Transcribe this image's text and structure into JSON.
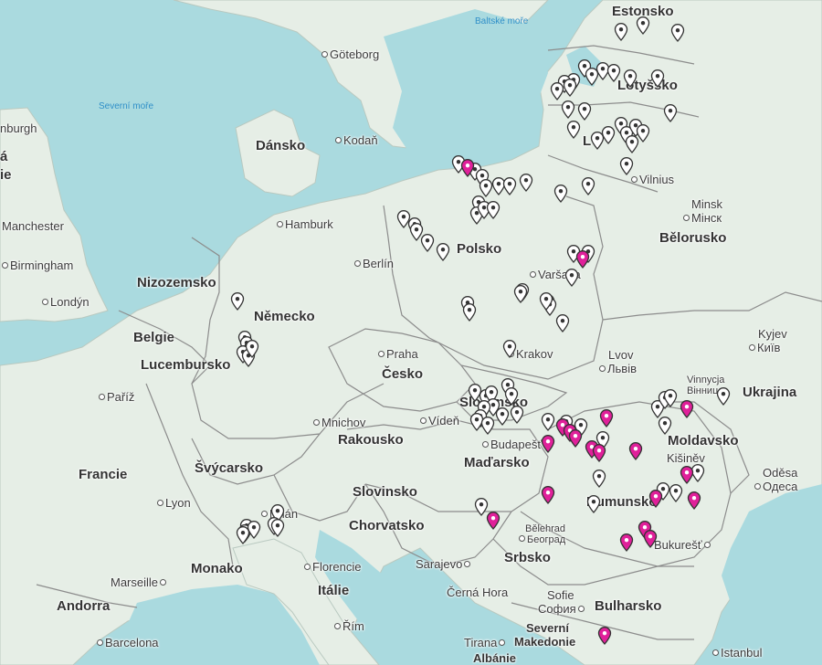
{
  "labels": {
    "estonsko": "Estonsko",
    "lotyssko": "Lotyšsko",
    "litva_partial": "L",
    "baltske_more": "Baltské moře",
    "goteborg": "Göteborg",
    "severni_more": "Severní moře",
    "edinburgh_partial": "nburgh",
    "ireland_partial_1": "á",
    "ireland_partial_2": "ie",
    "dansko": "Dánsko",
    "kodan": "Kodaň",
    "vilnius": "Vilnius",
    "minsk": "Minsk",
    "minsk_cyr": "Мінск",
    "manchester": "Manchester",
    "hamburk": "Hamburk",
    "polsko": "Polsko",
    "belorusko": "Bělorusko",
    "birmingham": "Birmingham",
    "berlin": "Berlín",
    "varsava": "Varšava",
    "nizozemsko": "Nizozemsko",
    "londyn": "Londýn",
    "nemecko": "Německo",
    "kyjev": "Kyjev",
    "kyjev_cyr": "Київ",
    "belgie": "Belgie",
    "praha": "Praha",
    "krakov": "Krakov",
    "lvov": "Lvov",
    "lvov_cyr": "Львів",
    "lucembursko": "Lucembursko",
    "cesko": "Česko",
    "vinnycja": "Vinnycja",
    "vinnycja_cyr": "Вінниця",
    "pariz": "Paříž",
    "slovensko": "Slovensko",
    "ukrajina": "Ukrajina",
    "mnichov": "Mnichov",
    "viden": "Vídeň",
    "rakousko": "Rakousko",
    "budapest": "Budapešť",
    "moldavsko": "Moldavsko",
    "kisinev": "Kišiněv",
    "madarsko": "Maďarsko",
    "francie": "Francie",
    "svycarsko": "Švýcarsko",
    "odesa": "Oděsa",
    "odesa_cyr": "Одеса",
    "lyon": "Lyon",
    "slovinsko": "Slovinsko",
    "rumunsko": "Rumunsko",
    "milan": "Milán",
    "chorvatsko": "Chorvatsko",
    "belehrad": "Bělehrad",
    "belehrad_cyr": "Београд",
    "monako": "Monako",
    "srbsko": "Srbsko",
    "bukurest": "Bukurešť",
    "marseille": "Marseille",
    "florencie": "Florencie",
    "sarajevo": "Sarajevo",
    "italie": "Itálie",
    "cerna_hora": "Černá Hora",
    "sofie": "Sofie",
    "sofie_cyr": "София",
    "bulharsko": "Bulharsko",
    "andorra": "Andorra",
    "rim": "Řím",
    "severni_makedonie_1": "Severní",
    "severni_makedonie_2": "Makedonie",
    "barcelona": "Barcelona",
    "tirana": "Tirana",
    "albanie": "Albánie",
    "istanbul": "Istanbul"
  },
  "colors": {
    "water": "#aadadf",
    "land": "#e6eee6",
    "border": "#8c8c8c",
    "marker_default": "#ffffff",
    "marker_highlight": "#e0209a",
    "marker_outline": "#333333"
  },
  "markers": {
    "default_count": 129,
    "highlighted_count": 28,
    "icon": "map-pin-icon"
  }
}
